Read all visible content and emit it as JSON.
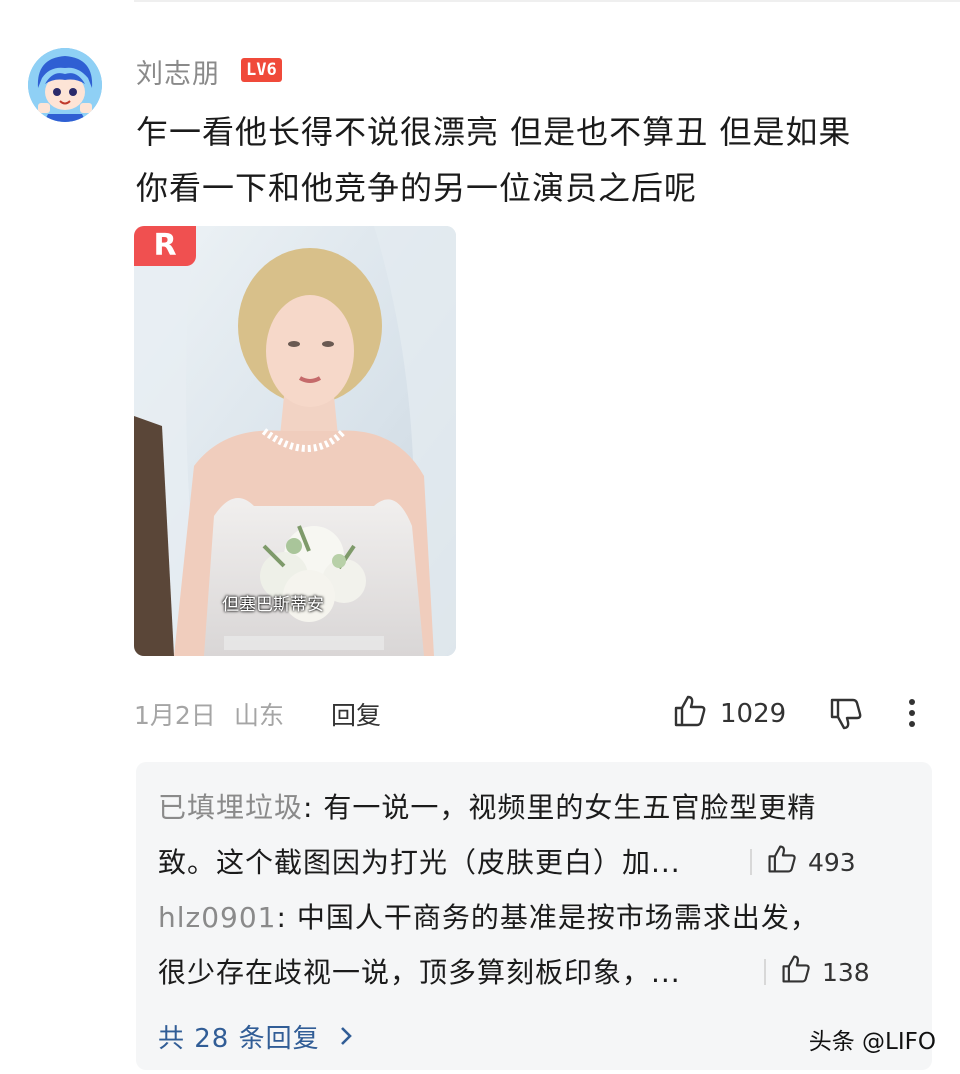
{
  "comment": {
    "username": "刘志朋",
    "level_badge": "LV6",
    "text_line1": "乍一看他长得不说很漂亮 但是也不算丑 但是如果",
    "text_line2": "你看一下和他竞争的另一位演员之后呢",
    "video": {
      "subtitle": "但塞巴斯蒂安",
      "logo_letter": "R"
    },
    "date": "1月2日",
    "location": "山东",
    "reply_label": "回复",
    "like_count": "1029",
    "icons": [
      "avatar",
      "thumbs-up-icon",
      "thumbs-down-icon",
      "more-vertical-icon"
    ]
  },
  "replies": [
    {
      "author": "已填埋垃圾",
      "line1": ": 有一说一，视频里的女生五官脸型更精",
      "line2": "致。这个截图因为打光（皮肤更白）加...",
      "like_count": "493"
    },
    {
      "author": "hlz0901",
      "line1": ": 中国人干商务的基准是按市场需求出发，",
      "line2": "很少存在歧视一说，顶多算刻板印象，...",
      "like_count": "138"
    }
  ],
  "view_replies_label": "共 28 条回复",
  "watermark": "头条 @LIFO",
  "colors": {
    "badge": "#f04a3a",
    "link": "#315d96",
    "reply_bg": "#f5f6f7",
    "muted": "#a5a5a5"
  }
}
